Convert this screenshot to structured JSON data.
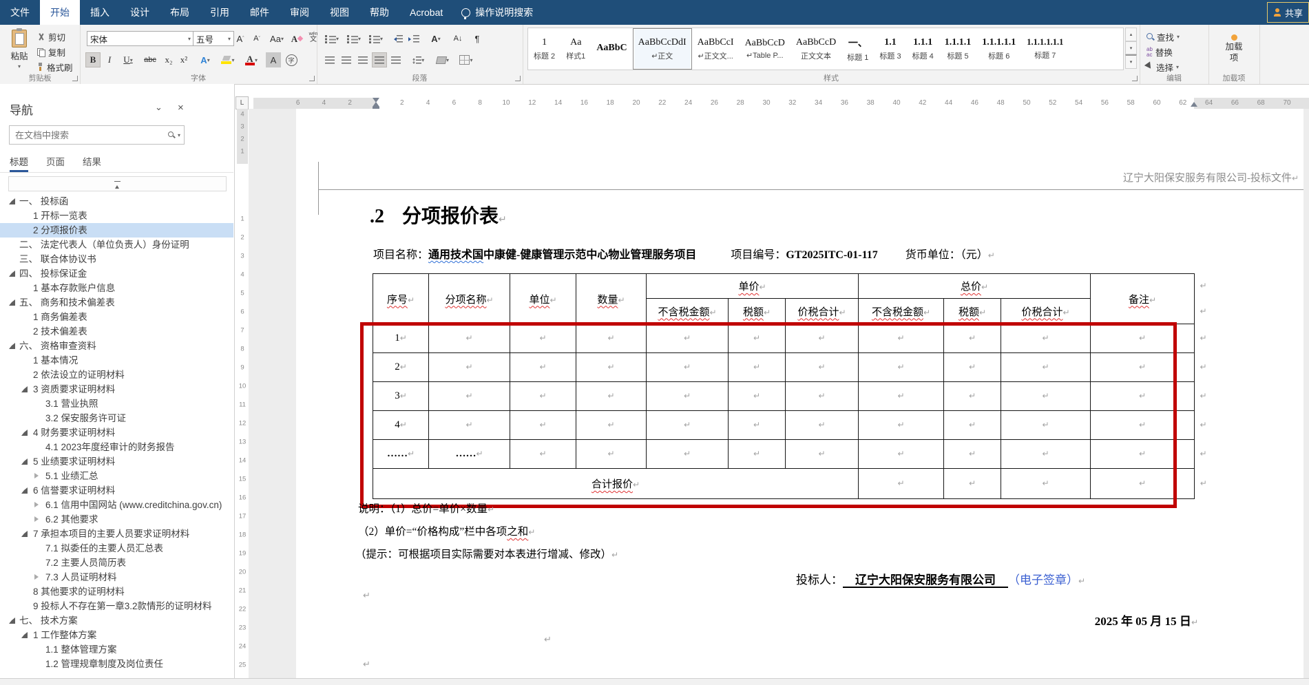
{
  "colors": {
    "titlebar": "#1f4e79",
    "accent": "#2b579a",
    "annotation_red": "#c00000",
    "seal_blue": "#3a5fd1",
    "nav_selection": "#c9def5"
  },
  "menu": {
    "tabs": [
      "文件",
      "开始",
      "插入",
      "设计",
      "布局",
      "引用",
      "邮件",
      "审阅",
      "视图",
      "帮助",
      "Acrobat"
    ],
    "active_tab": "开始",
    "tell_me": "操作说明搜索",
    "share_label": "共享"
  },
  "ribbon": {
    "clipboard": {
      "group_label": "剪贴板",
      "paste": "粘贴",
      "cut": "剪切",
      "copy": "复制",
      "format_painter": "格式刷"
    },
    "font": {
      "group_label": "字体",
      "name": "宋体",
      "size": "五号",
      "bold": "B",
      "italic": "I",
      "underline": "U",
      "strikethrough": "abc",
      "subscript": "x₂",
      "superscript": "x²",
      "grow": "A",
      "shrink": "A",
      "change_case": "Aa",
      "clear_format": "A",
      "phonetic_top": "wén",
      "phonetic_bottom": "文",
      "char_border": "A",
      "text_effects": "A",
      "char_shading": "A",
      "enclose": "字"
    },
    "paragraph": {
      "group_label": "段落",
      "sort": "A↓",
      "pilcrow": "¶",
      "spacing": "↕",
      "asian": "A"
    },
    "styles": {
      "group_label": "样式",
      "items": [
        {
          "preview": "1",
          "label": "标题 2"
        },
        {
          "preview": "Aa",
          "label": "样式1"
        },
        {
          "preview": "AaBbC",
          "label": "",
          "bold": true
        },
        {
          "preview": "AaBbCcDdI",
          "label": "↵正文",
          "selected": true
        },
        {
          "preview": "AaBbCcI",
          "label": "↵正文文..."
        },
        {
          "preview": "AaBbCcD",
          "label": "↵Table P..."
        },
        {
          "preview": "AaBbCcD",
          "label": "正文文本"
        },
        {
          "preview": "一、",
          "label": "标题 1",
          "bold": true
        },
        {
          "preview": "1.1",
          "label": "标题 3",
          "bold": true
        },
        {
          "preview": "1.1.1",
          "label": "标题 4",
          "bold": true
        },
        {
          "preview": "1.1.1.1",
          "label": "标题 5",
          "bold": true
        },
        {
          "preview": "1.1.1.1.1",
          "label": "标题 6",
          "bold": true
        },
        {
          "preview": "1.1.1.1.1.1",
          "label": "标题 7",
          "bold": true
        }
      ]
    },
    "editing": {
      "group_label": "编辑",
      "find": "查找",
      "replace": "替换",
      "select": "选择"
    },
    "addins": {
      "group_label": "加载项",
      "button_label": "加载项"
    }
  },
  "navigation": {
    "title": "导航",
    "search_placeholder": "在文档中搜索",
    "tabs": [
      "标题",
      "页面",
      "结果"
    ],
    "active_tab": "标题",
    "items": [
      {
        "text": "一、 投标函",
        "level": 1,
        "expander": "open"
      },
      {
        "text": "1 开标一览表",
        "level": 2
      },
      {
        "text": "2 分项报价表",
        "level": 2,
        "selected": true
      },
      {
        "text": "二、 法定代表人（单位负责人）身份证明",
        "level": 1
      },
      {
        "text": "三、 联合体协议书",
        "level": 1
      },
      {
        "text": "四、 投标保证金",
        "level": 1,
        "expander": "open"
      },
      {
        "text": "1 基本存款账户信息",
        "level": 2
      },
      {
        "text": "五、 商务和技术偏差表",
        "level": 1,
        "expander": "open"
      },
      {
        "text": "1 商务偏差表",
        "level": 2
      },
      {
        "text": "2 技术偏差表",
        "level": 2
      },
      {
        "text": "六、 资格审查资料",
        "level": 1,
        "expander": "open"
      },
      {
        "text": "1 基本情况",
        "level": 2
      },
      {
        "text": "2 依法设立的证明材料",
        "level": 2
      },
      {
        "text": "3 资质要求证明材料",
        "level": 2,
        "expander": "open"
      },
      {
        "text": "3.1 营业执照",
        "level": 3
      },
      {
        "text": "3.2 保安服务许可证",
        "level": 3
      },
      {
        "text": "4 财务要求证明材料",
        "level": 2,
        "expander": "open"
      },
      {
        "text": "4.1 2023年度经审计的财务报告",
        "level": 3
      },
      {
        "text": "5 业绩要求证明材料",
        "level": 2,
        "expander": "open"
      },
      {
        "text": "5.1 业绩汇总",
        "level": 3,
        "expander": "closed"
      },
      {
        "text": "6 信誉要求证明材料",
        "level": 2,
        "expander": "open"
      },
      {
        "text": "6.1 信用中国网站 (www.creditchina.gov.cn)",
        "level": 3,
        "expander": "closed"
      },
      {
        "text": "6.2 其他要求",
        "level": 3,
        "expander": "closed"
      },
      {
        "text": "7 承担本项目的主要人员要求证明材料",
        "level": 2,
        "expander": "open"
      },
      {
        "text": "7.1 拟委任的主要人员汇总表",
        "level": 3
      },
      {
        "text": "7.2 主要人员简历表",
        "level": 3
      },
      {
        "text": "7.3 人员证明材料",
        "level": 3,
        "expander": "closed"
      },
      {
        "text": "8 其他要求的证明材料",
        "level": 2
      },
      {
        "text": "9 投标人不存在第一章3.2款情形的证明材料",
        "level": 2
      },
      {
        "text": "七、 技术方案",
        "level": 1,
        "expander": "open"
      },
      {
        "text": "1 工作整体方案",
        "level": 2,
        "expander": "open"
      },
      {
        "text": "1.1 整体管理方案",
        "level": 3
      },
      {
        "text": "1.2 管理规章制度及岗位责任",
        "level": 3
      }
    ]
  },
  "ruler": {
    "tab_selector": "L",
    "h_left": [
      "6",
      "4",
      "2"
    ],
    "h_right": [
      "2",
      "4",
      "6",
      "8",
      "10",
      "12",
      "14",
      "16",
      "18",
      "20",
      "22",
      "24",
      "26",
      "28",
      "30",
      "32",
      "34",
      "36",
      "38",
      "40",
      "42",
      "44",
      "46",
      "48",
      "50",
      "52",
      "54",
      "56",
      "58",
      "60",
      "62",
      "64",
      "66",
      "68",
      "70"
    ],
    "v_top": [
      "4",
      "3",
      "2",
      "1"
    ],
    "v_side": [
      "1",
      "2",
      "3",
      "4",
      "5",
      "6",
      "7",
      "8",
      "9",
      "10",
      "11",
      "12",
      "13",
      "14",
      "15",
      "16",
      "17",
      "18",
      "19",
      "20",
      "21",
      "22",
      "23",
      "24",
      "25"
    ]
  },
  "document": {
    "page_header": "辽宁大阳保安服务有限公司-投标文件",
    "heading_num": ".2",
    "heading_text": "分项报价表",
    "meta": {
      "name_label": "项目名称：",
      "name_wavy": "通用技术国",
      "name_rest": "中康健-健康管理示范中心物业管理服务项目",
      "code_label": "项目编号：",
      "code": "GT2025ITC-01-117",
      "currency": "货币单位：（元）"
    },
    "table": {
      "h_no": "序号",
      "h_item": "分项名称",
      "h_unit": "单位",
      "h_qty": "数量",
      "h_unit_price": "单价",
      "h_total_price": "总价",
      "h_sub": [
        "不含税金额",
        "税额",
        "价税合计"
      ],
      "h_remark": "备注",
      "rows": [
        [
          "1"
        ],
        [
          "2"
        ],
        [
          "3"
        ],
        [
          "4"
        ],
        [
          "……",
          "……"
        ]
      ],
      "total_label": "合计报价"
    },
    "note1": "说明：（1）总价=单价×数量",
    "note2_pre": "（2）单价=“价格构成”栏中各项",
    "note2_wavy": "之和",
    "note3": "（提示：可根据项目实际需要对本表进行增减、修改）",
    "bidder_label": "投标人：",
    "bidder_name": "辽宁大阳保安服务有限公司",
    "bidder_seal": "（电子签章）",
    "date": "2025 年 05 月 15 日",
    "pilcrow": "↵"
  }
}
